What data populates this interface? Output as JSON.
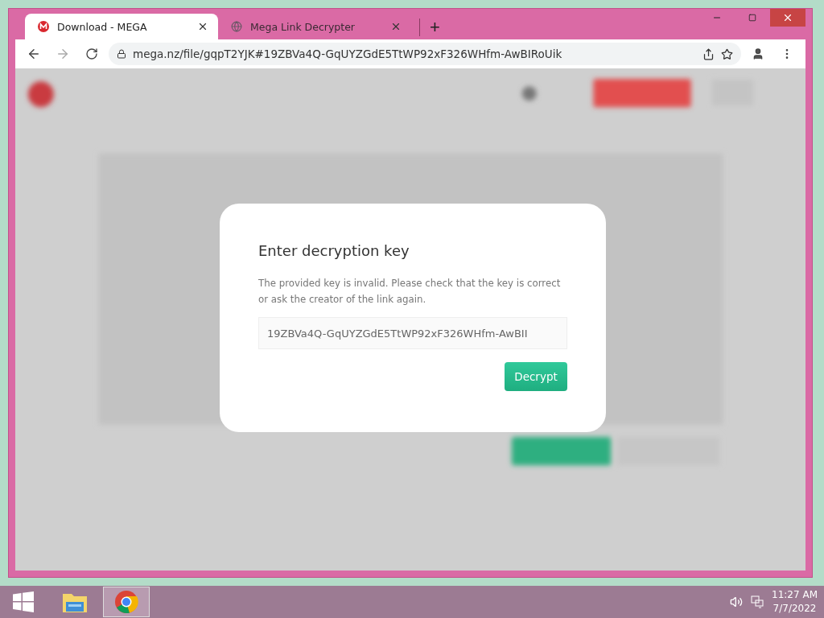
{
  "tabs": [
    {
      "title": "Download - MEGA",
      "selected": true,
      "kind": "mega"
    },
    {
      "title": "Mega Link Decrypter",
      "selected": false,
      "kind": "globe"
    }
  ],
  "new_tab": "+",
  "address_bar": {
    "url": "mega.nz/file/gqpT2YJK#19ZBVa4Q-GqUYZGdE5TtWP92xF326WHfm-AwBIRoUik"
  },
  "dialog": {
    "title": "Enter decryption key",
    "message": "The provided key is invalid. Please check that the key is correct or ask the creator of the link again.",
    "key_field": {
      "value": "19ZBVa4Q-GqUYZGdE5TtWP92xF326WHfm-AwBII"
    },
    "button": "Decrypt"
  },
  "taskbar": {
    "apps": [
      {
        "kind": "folder",
        "selected": false
      },
      {
        "kind": "chrome",
        "selected": true
      }
    ],
    "time": "11:27 AM",
    "date": "7/7/2022"
  }
}
